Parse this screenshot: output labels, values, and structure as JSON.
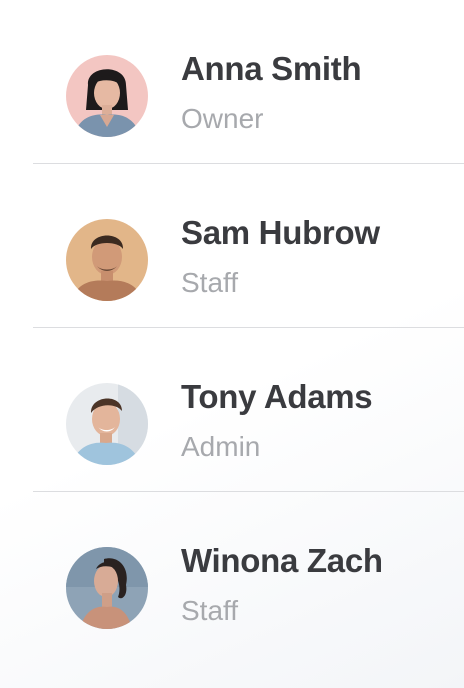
{
  "members": [
    {
      "name": "Anna Smith",
      "role": "Owner"
    },
    {
      "name": "Sam Hubrow",
      "role": "Staff"
    },
    {
      "name": "Tony Adams",
      "role": "Admin"
    },
    {
      "name": "Winona Zach",
      "role": "Staff"
    }
  ]
}
